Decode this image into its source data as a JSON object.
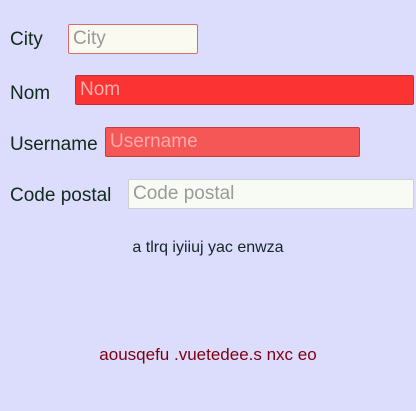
{
  "form": {
    "city": {
      "label": "City",
      "placeholder": "City",
      "value": ""
    },
    "nom": {
      "label": "Nom",
      "placeholder": "Nom",
      "value": ""
    },
    "username": {
      "label": "Username",
      "placeholder": "Username",
      "value": ""
    },
    "postal": {
      "label": "Code postal",
      "placeholder": "Code postal",
      "value": ""
    }
  },
  "texts": {
    "line1": "a tlrq iyiiuj yac enwza",
    "line2": "aousqefu .vuetedee.s  nxc eo"
  },
  "colors": {
    "background": "#dcdcfc",
    "nom_field": "#fc3333",
    "username_field": "#f55656",
    "red_text": "#7d0010"
  }
}
